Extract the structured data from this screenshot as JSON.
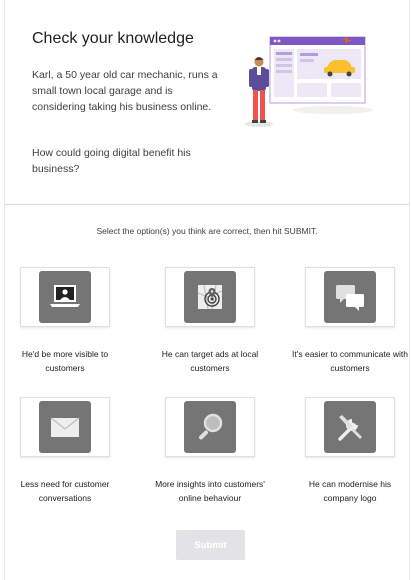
{
  "header": {
    "title": "Check your knowledge",
    "scenario": "Karl, a 50 year old car mechanic, runs a small town local garage and is considering taking his business online.",
    "question": "How could going digital benefit his business?"
  },
  "instruction": "Select the option(s) you think are correct, then hit SUBMIT.",
  "options": [
    {
      "label": "He'd be more visible to customers",
      "icon": "laptop-person-icon"
    },
    {
      "label": "He can target ads at local customers",
      "icon": "map-target-icon"
    },
    {
      "label": "It's easier to communicate with customers",
      "icon": "chat-bubbles-icon"
    },
    {
      "label": "Less need for customer conversations",
      "icon": "envelope-icon"
    },
    {
      "label": "More insights into customers' online behaviour",
      "icon": "magnifier-icon"
    },
    {
      "label": "He can modernise his company logo",
      "icon": "tools-icon"
    }
  ],
  "submit_label": "Submit",
  "colors": {
    "tile": "#757575",
    "submit_disabled": "#e3e3e6",
    "browser_accent": "#7e57c2",
    "car": "#fbc02d"
  }
}
